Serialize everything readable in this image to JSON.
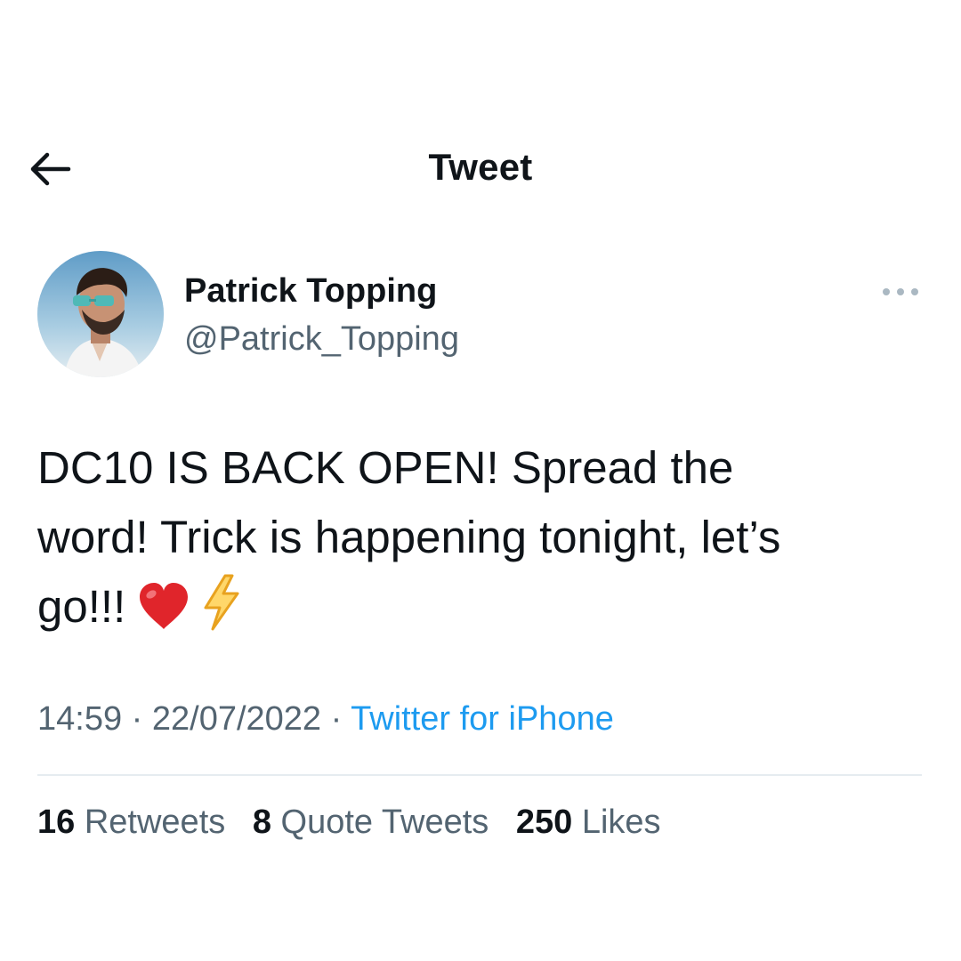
{
  "header": {
    "back_icon": "arrow-left-icon",
    "title": "Tweet"
  },
  "author": {
    "name": "Patrick Topping",
    "handle": "@Patrick_Topping"
  },
  "more_icon": "ellipsis-icon",
  "tweet": {
    "lines": [
      "DC10 IS BACK OPEN! Spread the",
      "word! Trick is happening tonight, let’s",
      "go!!!"
    ],
    "emojis": [
      "heart-emoji",
      "lightning-emoji"
    ]
  },
  "meta": {
    "time": "14:59",
    "separator": " · ",
    "date": "22/07/2022",
    "source": "Twitter for iPhone"
  },
  "stats": {
    "retweets_count": "16",
    "retweets_label": "Retweets",
    "quotes_count": "8",
    "quotes_label": "Quote Tweets",
    "likes_count": "250",
    "likes_label": "Likes"
  },
  "colors": {
    "text": "#0f1419",
    "secondary": "#536471",
    "link": "#1d9bf0",
    "divider": "#e6ecf0"
  }
}
